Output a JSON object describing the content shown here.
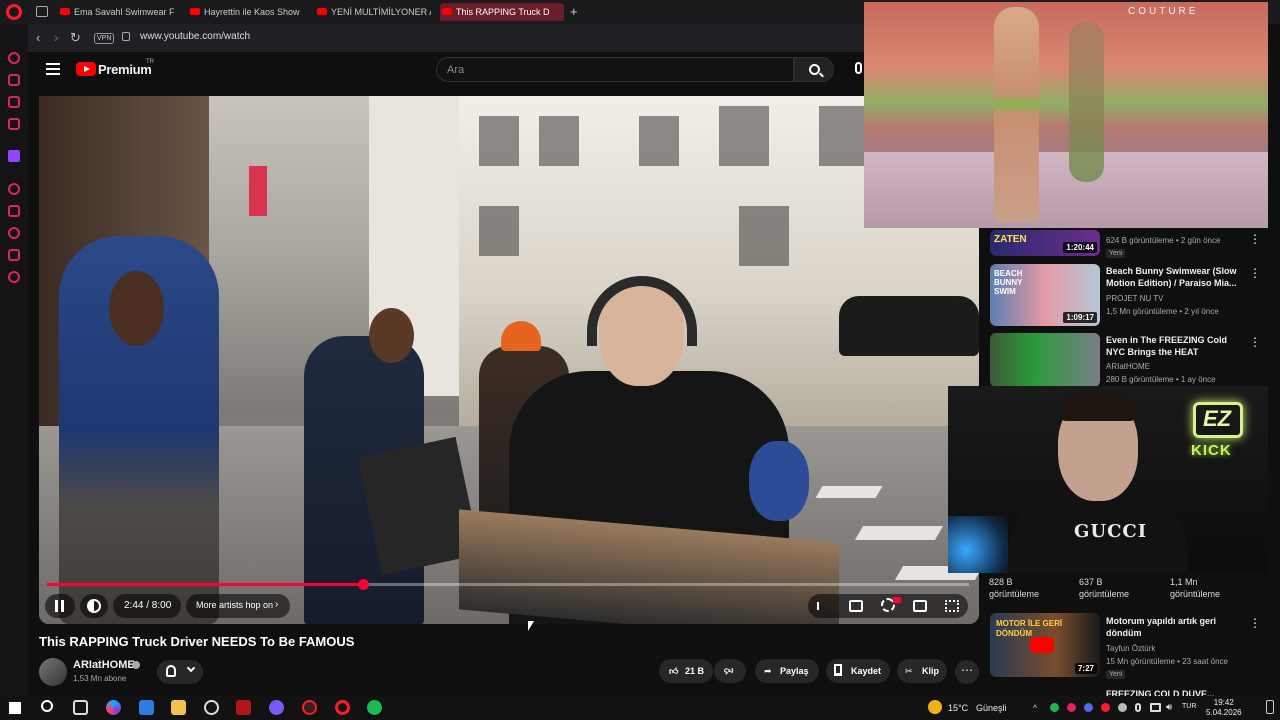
{
  "browser": {
    "tabs": [
      {
        "label": "Ema Savahl Swimwear Fas"
      },
      {
        "label": "Hayrettin ile Kaos Show -"
      },
      {
        "label": "YENİ MULTİMİLYONER AR"
      },
      {
        "label": "This RAPPING Truck D"
      }
    ],
    "vpn_label": "VPN",
    "url": "www.youtube.com/watch",
    "new_tab_glyph": "+"
  },
  "youtube": {
    "brand": "Premium",
    "brand_tr": "TR",
    "search_placeholder": "Ara"
  },
  "player": {
    "time_display": "2:44 / 8:00",
    "chapter_label": "More artists hop on",
    "progress_fraction": 0.343
  },
  "video": {
    "title": "This RAPPING Truck Driver NEEDS To Be FAMOUS",
    "channel_name": "ARIatHOME",
    "subscribers": "1,53 Mn abone",
    "likes": "21 B",
    "share_label": "Paylaş",
    "save_label": "Kaydet",
    "clip_label": "Klip",
    "more_glyph": "⋯"
  },
  "recommendations": [
    {
      "thumb_text": "ZATEN",
      "duration": "1:20:44",
      "title": "",
      "channel": "",
      "meta": "624 B görüntüleme • 2 gün önce",
      "badge": "Yeni"
    },
    {
      "thumb_text": "BEACH BUNNY SWIM",
      "duration": "1:09:17",
      "title": "Beach Bunny Swimwear (Slow Motion Edition) / Paraiso Mia...",
      "channel": "PROJET NU TV",
      "meta": "1,5 Mn görüntüleme • 2 yıl önce",
      "badge": ""
    },
    {
      "thumb_text": "",
      "duration": "",
      "title": "Even in The FREEZING Cold NYC Brings the HEAT",
      "channel": "ARIatHOME",
      "meta": "280 B görüntüleme • 1 ay önce",
      "badge": ""
    },
    {
      "thumb_text": "MOTOR İLE GERİ DÖNDÜM",
      "duration": "7:27",
      "title": "Motorum yapıldı artık geri döndüm",
      "channel": "Tayfun Öztürk",
      "meta": "15 Mn görüntüleme • 23 saat önce",
      "badge": "Yeni"
    }
  ],
  "shorts_stats": [
    {
      "count": "828 B",
      "label": "görüntüleme"
    },
    {
      "count": "637 B",
      "label": "görüntüleme"
    },
    {
      "count": "1,1 Mn",
      "label": "görüntüleme"
    }
  ],
  "partial_title": "FREEZING COLD DUVE...",
  "overlays": {
    "pip_brand": "COUTURE",
    "cam_shirt": "GUCCI",
    "cam_sign_1": "EZ",
    "cam_sign_2": "KICK"
  },
  "taskbar": {
    "temperature": "15°C",
    "weather": "Güneşli",
    "lang": "TUR",
    "time": "19:42",
    "date": "5.04.2026"
  },
  "colors": {
    "accent": "#ff0033",
    "opera": "#ff1b2d",
    "kick": "#c3f45b"
  }
}
